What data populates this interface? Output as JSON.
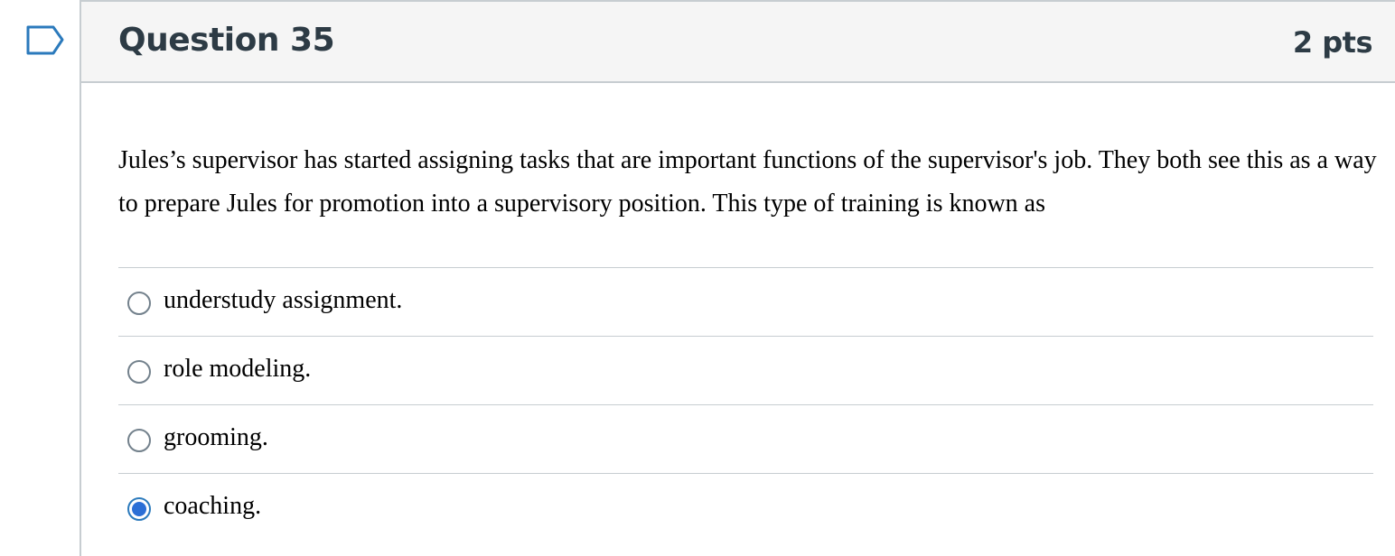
{
  "question": {
    "title": "Question 35",
    "points": "2 pts",
    "text": "Jules’s supervisor has started assigning tasks that are important functions of the supervisor's job. They both see this as a way to prepare Jules for promotion into a supervisory position. This type of training is known as",
    "answers": [
      {
        "label": "understudy assignment.",
        "selected": false
      },
      {
        "label": "role modeling.",
        "selected": false
      },
      {
        "label": "grooming.",
        "selected": false
      },
      {
        "label": "coaching.",
        "selected": true
      }
    ]
  },
  "flag": {
    "icon": "flag-bookmark-icon"
  },
  "colors": {
    "header_bg": "#f5f5f5",
    "border": "#c7cdd1",
    "selected": "#2b6fd6",
    "title_text": "#2d3b45"
  }
}
